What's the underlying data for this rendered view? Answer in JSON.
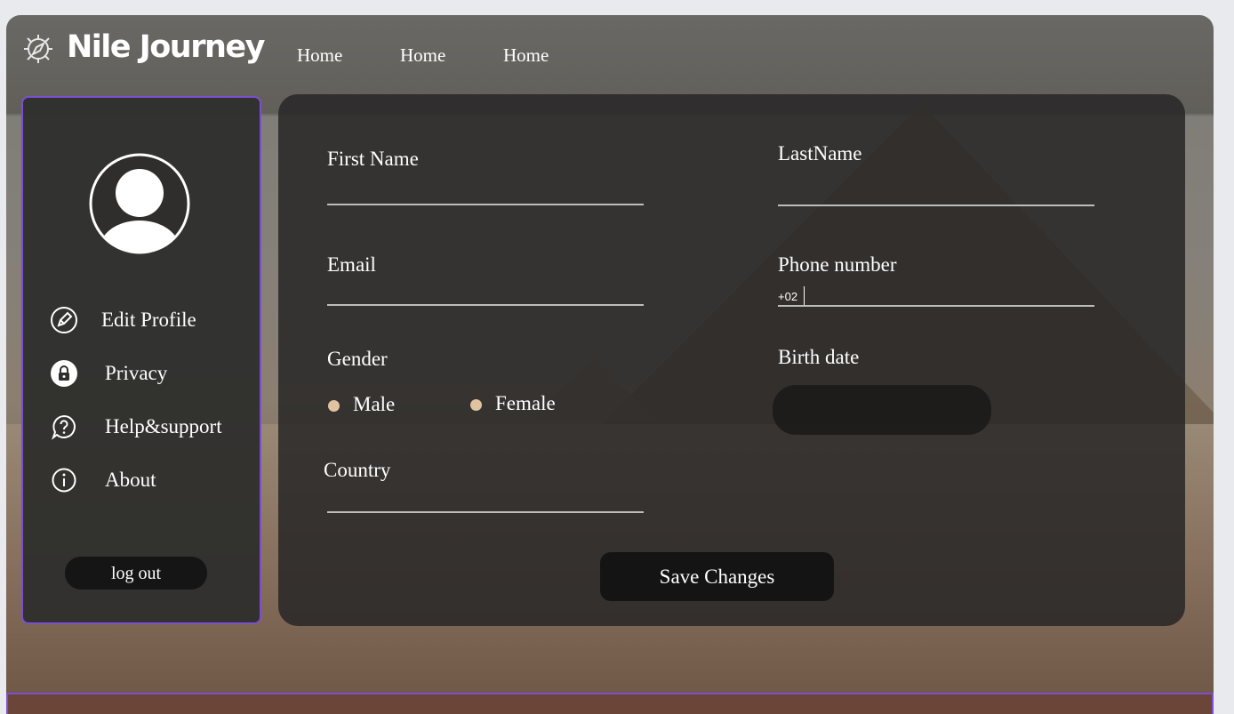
{
  "header": {
    "brand": "Nile Journey",
    "brand_icon": "compass-icon",
    "nav": [
      "Home",
      "Home",
      "Home"
    ]
  },
  "sidebar": {
    "avatar_icon": "user-avatar-icon",
    "items": [
      {
        "label": "Edit Profile",
        "icon": "pencil-circle-icon"
      },
      {
        "label": "Privacy",
        "icon": "lock-icon"
      },
      {
        "label": "Help&support",
        "icon": "help-chat-icon"
      },
      {
        "label": "About",
        "icon": "info-icon"
      }
    ],
    "logout_label": "log out"
  },
  "form": {
    "first_name_label": "First Name",
    "first_name_value": "",
    "last_name_label": "LastName",
    "last_name_value": "",
    "email_label": "Email",
    "email_value": "",
    "phone_label": "Phone number",
    "phone_prefix": "+02",
    "phone_value": "",
    "gender_label": "Gender",
    "gender_options": [
      "Male",
      "Female"
    ],
    "birth_date_label": "Birth date",
    "birth_date_value": "",
    "country_label": "Country",
    "country_value": "",
    "save_label": "Save Changes"
  },
  "colors": {
    "sidebar_border": "#7c4fd0",
    "radio_dot": "#e2c3a1",
    "footer_bg": "#6b4537"
  }
}
